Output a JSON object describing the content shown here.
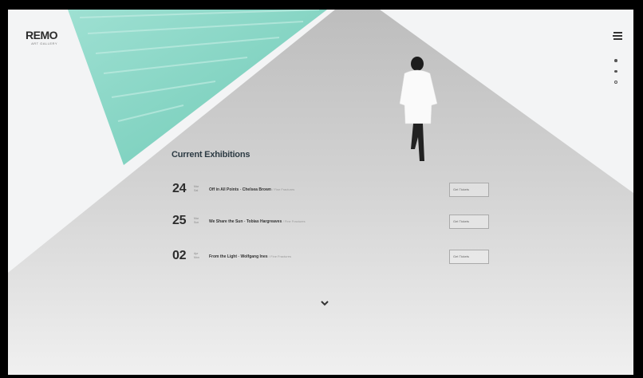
{
  "brand": {
    "name": "REMO",
    "tagline": "ART GALLERY"
  },
  "heading": "Current Exhibitions",
  "exhibitions": [
    {
      "day": "24",
      "month": "Mar",
      "weekday": "Sat",
      "title": "Off in All Points",
      "artist": "Chelsea Brown",
      "category": "Fine Fractures",
      "button": "Get Tickets"
    },
    {
      "day": "25",
      "month": "Mar",
      "weekday": "Sun",
      "title": "We Share the Sun",
      "artist": "Tobias Hargreaves",
      "category": "Fine Fractures",
      "button": "Get Tickets"
    },
    {
      "day": "02",
      "month": "Apr",
      "weekday": "Mon",
      "title": "From the Light",
      "artist": "Wolfgang Ines",
      "category": "Fine Fractures",
      "button": "Get Tickets"
    }
  ],
  "icons": {
    "menu": "hamburger-icon",
    "scroll": "chevron-down-icon",
    "nav": "dot-nav-icon"
  },
  "colors": {
    "accent": "#7fd3c0",
    "text": "#2d3b44",
    "background": "#f3f4f5"
  }
}
